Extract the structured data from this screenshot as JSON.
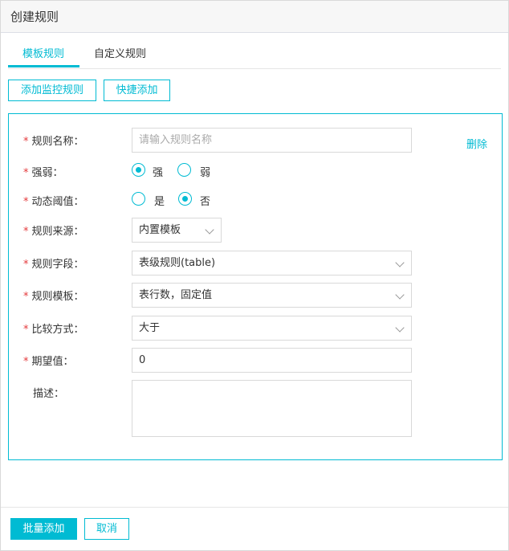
{
  "dialog": {
    "title": "创建规则"
  },
  "tabs": [
    {
      "label": "模板规则",
      "active": true
    },
    {
      "label": "自定义规则",
      "active": false
    }
  ],
  "toolbar": {
    "add_rule_label": "添加监控规则",
    "quick_add_label": "快捷添加"
  },
  "form": {
    "delete_label": "删除",
    "rule_name": {
      "label": "规则名称：",
      "placeholder": "请输入规则名称",
      "value": ""
    },
    "strength": {
      "label": "强弱：",
      "options": [
        "强",
        "弱"
      ],
      "selected": "强"
    },
    "dynamic_threshold": {
      "label": "动态阈值：",
      "options": [
        "是",
        "否"
      ],
      "selected": "否"
    },
    "rule_source": {
      "label": "规则来源：",
      "value": "内置模板"
    },
    "rule_field": {
      "label": "规则字段：",
      "value": "表级规则(table)"
    },
    "rule_template": {
      "label": "规则模板：",
      "value": "表行数，固定值"
    },
    "compare_method": {
      "label": "比较方式：",
      "value": "大于"
    },
    "expected_value": {
      "label": "期望值：",
      "value": "0"
    },
    "description": {
      "label": "描述：",
      "value": ""
    }
  },
  "footer": {
    "batch_add_label": "批量添加",
    "cancel_label": "取消"
  },
  "colors": {
    "accent": "#00bbd3",
    "required": "#e4393c"
  }
}
